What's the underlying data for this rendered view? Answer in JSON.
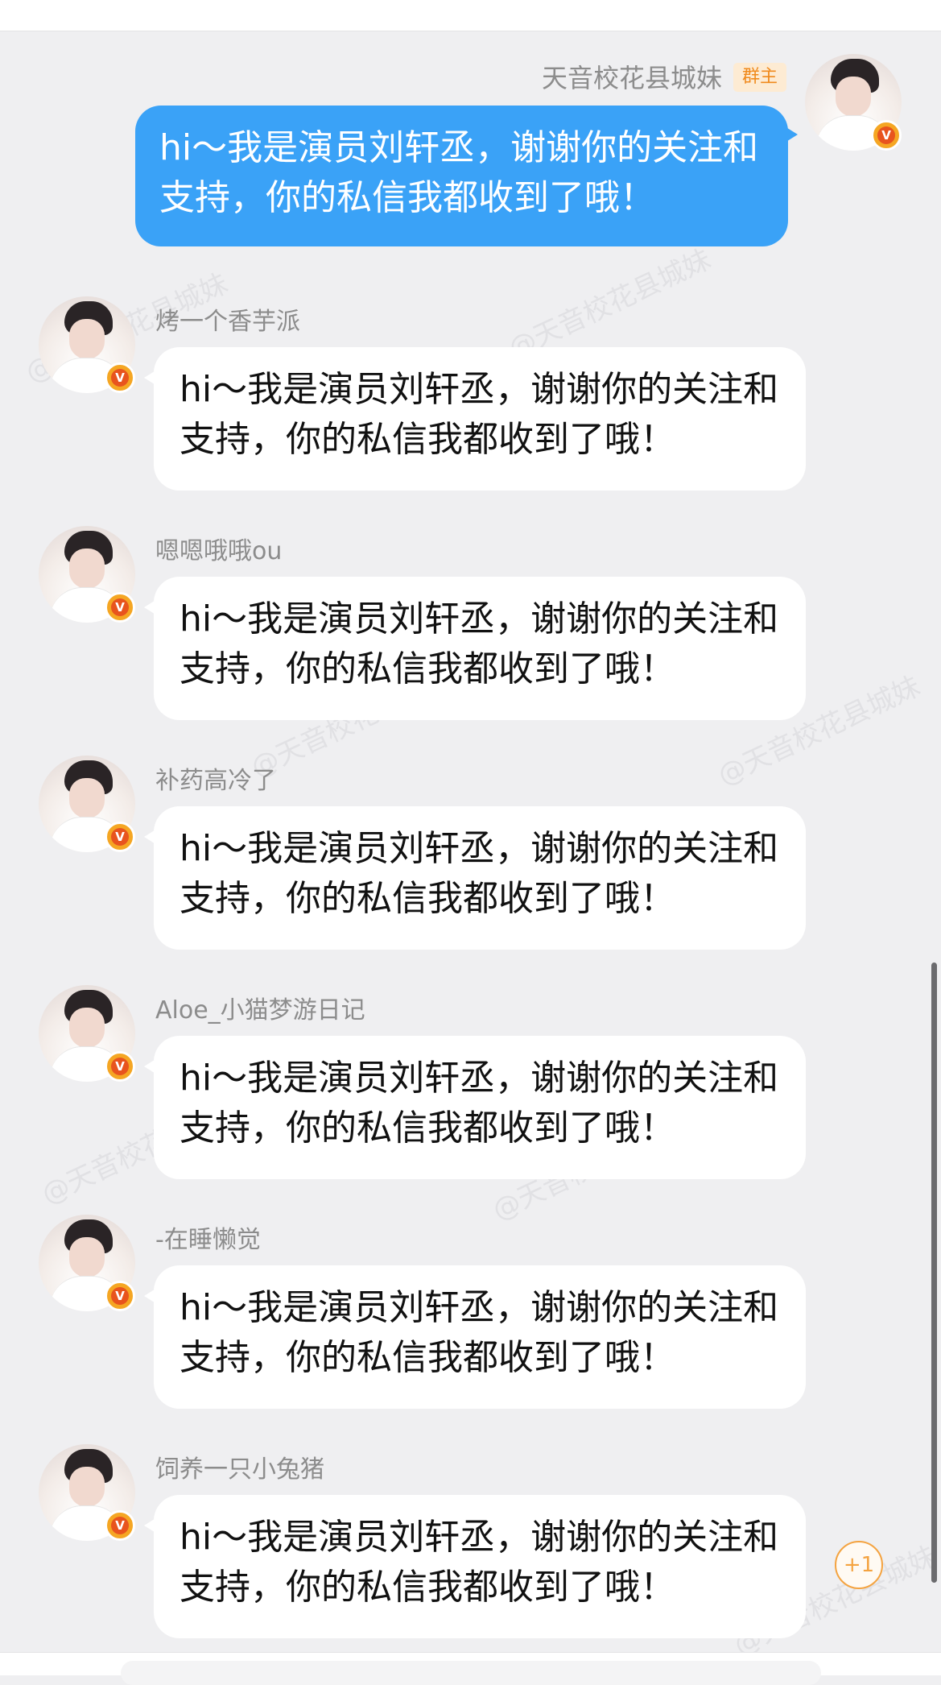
{
  "sent": {
    "name": "天音校花县城妹",
    "badge": "群主",
    "text": "hi～我是演员刘轩丞，谢谢你的关注和支持，你的私信我都收到了哦！"
  },
  "messages": [
    {
      "name": "烤一个香芋派",
      "text": "hi～我是演员刘轩丞，谢谢你的关注和支持，你的私信我都收到了哦！"
    },
    {
      "name": "嗯嗯哦哦ou",
      "text": "hi～我是演员刘轩丞，谢谢你的关注和支持，你的私信我都收到了哦！"
    },
    {
      "name": "补药高冷了",
      "text": "hi～我是演员刘轩丞，谢谢你的关注和支持，你的私信我都收到了哦！"
    },
    {
      "name": "Aloe_小猫梦游日记",
      "text": "hi～我是演员刘轩丞，谢谢你的关注和支持，你的私信我都收到了哦！"
    },
    {
      "name": "-在睡懒觉",
      "text": "hi～我是演员刘轩丞，谢谢你的关注和支持，你的私信我都收到了哦！"
    },
    {
      "name": "饲养一只小兔猪",
      "text": "hi～我是演员刘轩丞，谢谢你的关注和支持，你的私信我都收到了哦！"
    }
  ],
  "plus_one": "+1",
  "avatar_badge": "V",
  "watermark": "@天音校花县城妹",
  "colors": {
    "sent_bubble": "#3aa2f7",
    "owner_badge_text": "#f08a1c",
    "background": "#efeff1"
  }
}
